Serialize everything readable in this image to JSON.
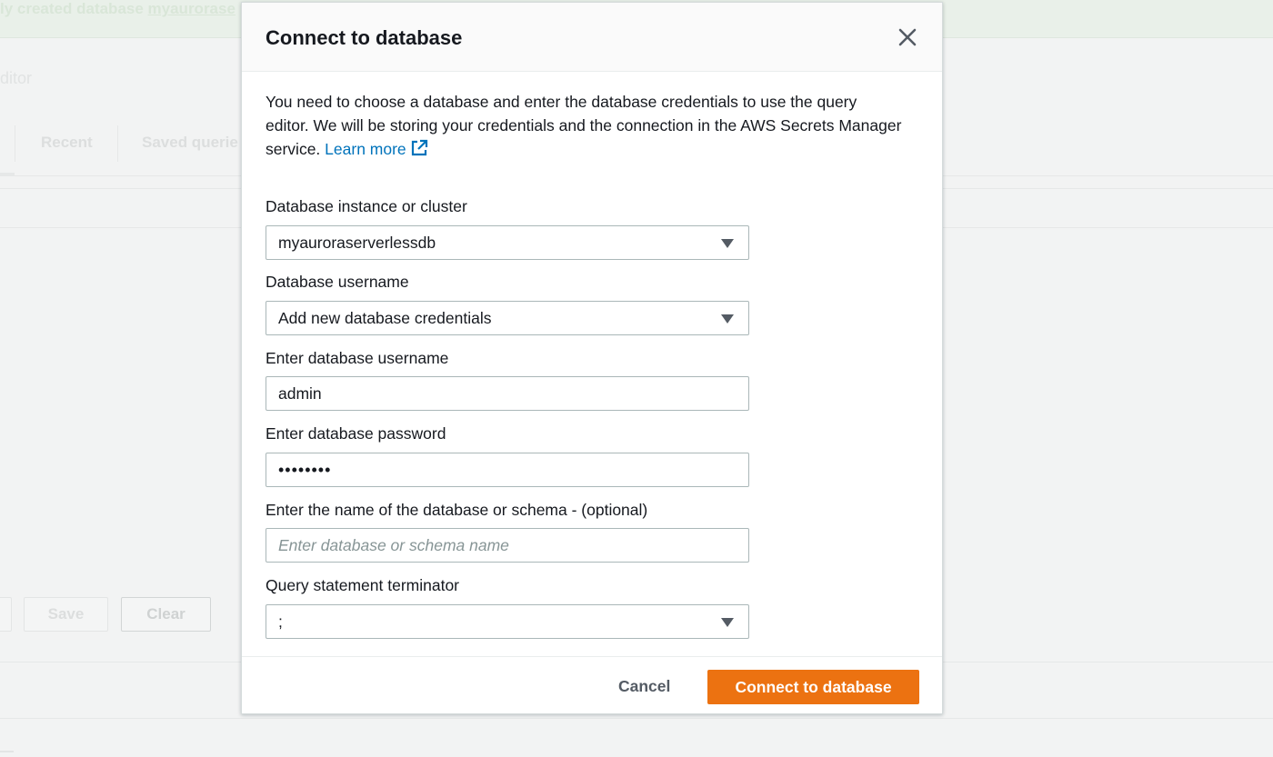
{
  "background": {
    "banner_prefix": "ly created database ",
    "banner_link": "myaurorase",
    "editor_label": "ditor",
    "tabs": [
      "Recent",
      "Saved querie"
    ],
    "buttons": {
      "save": "Save",
      "clear": "Clear"
    }
  },
  "modal": {
    "title": "Connect to database",
    "close_icon": "close-icon",
    "intro_text": "You need to choose a database and enter the database credentials to use the query editor. We will be storing your credentials and the connection in the AWS Secrets Manager service.",
    "learn_more": "Learn more",
    "external_link_icon": "external-link-icon",
    "fields": {
      "instance": {
        "label": "Database instance or cluster",
        "value": "myauroraserverlessdb"
      },
      "username_select": {
        "label": "Database username",
        "value": "Add new database credentials"
      },
      "username": {
        "label": "Enter database username",
        "value": "admin"
      },
      "password": {
        "label": "Enter database password",
        "value": "••••••••"
      },
      "schema": {
        "label": "Enter the name of the database or schema - (optional)",
        "value": "",
        "placeholder": "Enter database or schema name"
      },
      "terminator": {
        "label": "Query statement terminator",
        "value": ";"
      }
    },
    "footer": {
      "cancel": "Cancel",
      "connect": "Connect to database"
    },
    "colors": {
      "primary": "#ec7211",
      "link": "#0073bb"
    }
  }
}
